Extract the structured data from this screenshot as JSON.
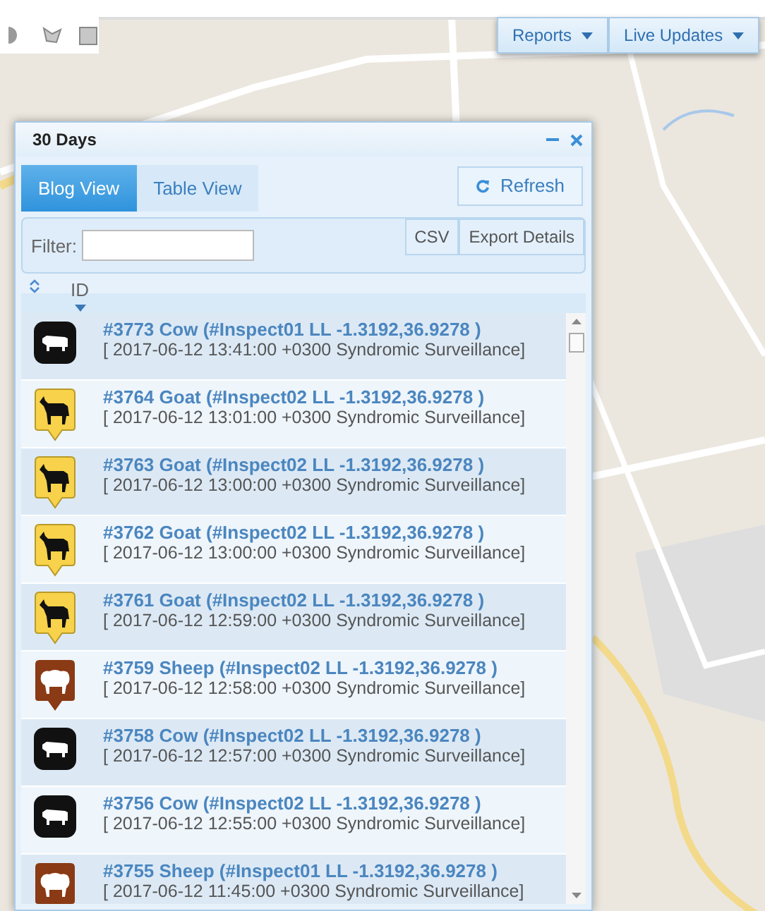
{
  "menu": [
    {
      "label": "Reports"
    },
    {
      "label": "Live Updates"
    }
  ],
  "panel": {
    "title": "30 Days",
    "tabs": [
      {
        "label": "Blog View",
        "selected": true
      },
      {
        "label": "Table View",
        "selected": false
      }
    ],
    "refresh": "Refresh",
    "filter": {
      "label": "Filter:"
    },
    "export_buttons": [
      "CSV",
      "Export Details"
    ],
    "sort_column": "ID",
    "rows": [
      {
        "kind": "cow",
        "title": "#3773 Cow (#Inspect01 LL -1.3192,36.9278 )",
        "detail": "[ 2017-06-12 13:41:00 +0300 Syndromic Surveillance]"
      },
      {
        "kind": "goat",
        "title": "#3764 Goat (#Inspect02 LL -1.3192,36.9278 )",
        "detail": "[ 2017-06-12 13:01:00 +0300 Syndromic Surveillance]"
      },
      {
        "kind": "goat",
        "title": "#3763 Goat (#Inspect02 LL -1.3192,36.9278 )",
        "detail": "[ 2017-06-12 13:00:00 +0300 Syndromic Surveillance]"
      },
      {
        "kind": "goat",
        "title": "#3762 Goat (#Inspect02 LL -1.3192,36.9278 )",
        "detail": "[ 2017-06-12 13:00:00 +0300 Syndromic Surveillance]"
      },
      {
        "kind": "goat",
        "title": "#3761 Goat (#Inspect02 LL -1.3192,36.9278 )",
        "detail": "[ 2017-06-12 12:59:00 +0300 Syndromic Surveillance]"
      },
      {
        "kind": "sheep",
        "title": "#3759 Sheep (#Inspect02 LL -1.3192,36.9278 )",
        "detail": "[ 2017-06-12 12:58:00 +0300 Syndromic Surveillance]"
      },
      {
        "kind": "cow",
        "title": "#3758 Cow (#Inspect02 LL -1.3192,36.9278 )",
        "detail": "[ 2017-06-12 12:57:00 +0300 Syndromic Surveillance]"
      },
      {
        "kind": "cow",
        "title": "#3756 Cow (#Inspect02 LL -1.3192,36.9278 )",
        "detail": "[ 2017-06-12 12:55:00 +0300 Syndromic Surveillance]"
      },
      {
        "kind": "sheep",
        "title": "#3755 Sheep (#Inspect01 LL -1.3192,36.9278 )",
        "detail": "[ 2017-06-12 11:45:00 +0300 Syndromic Surveillance]"
      }
    ]
  }
}
